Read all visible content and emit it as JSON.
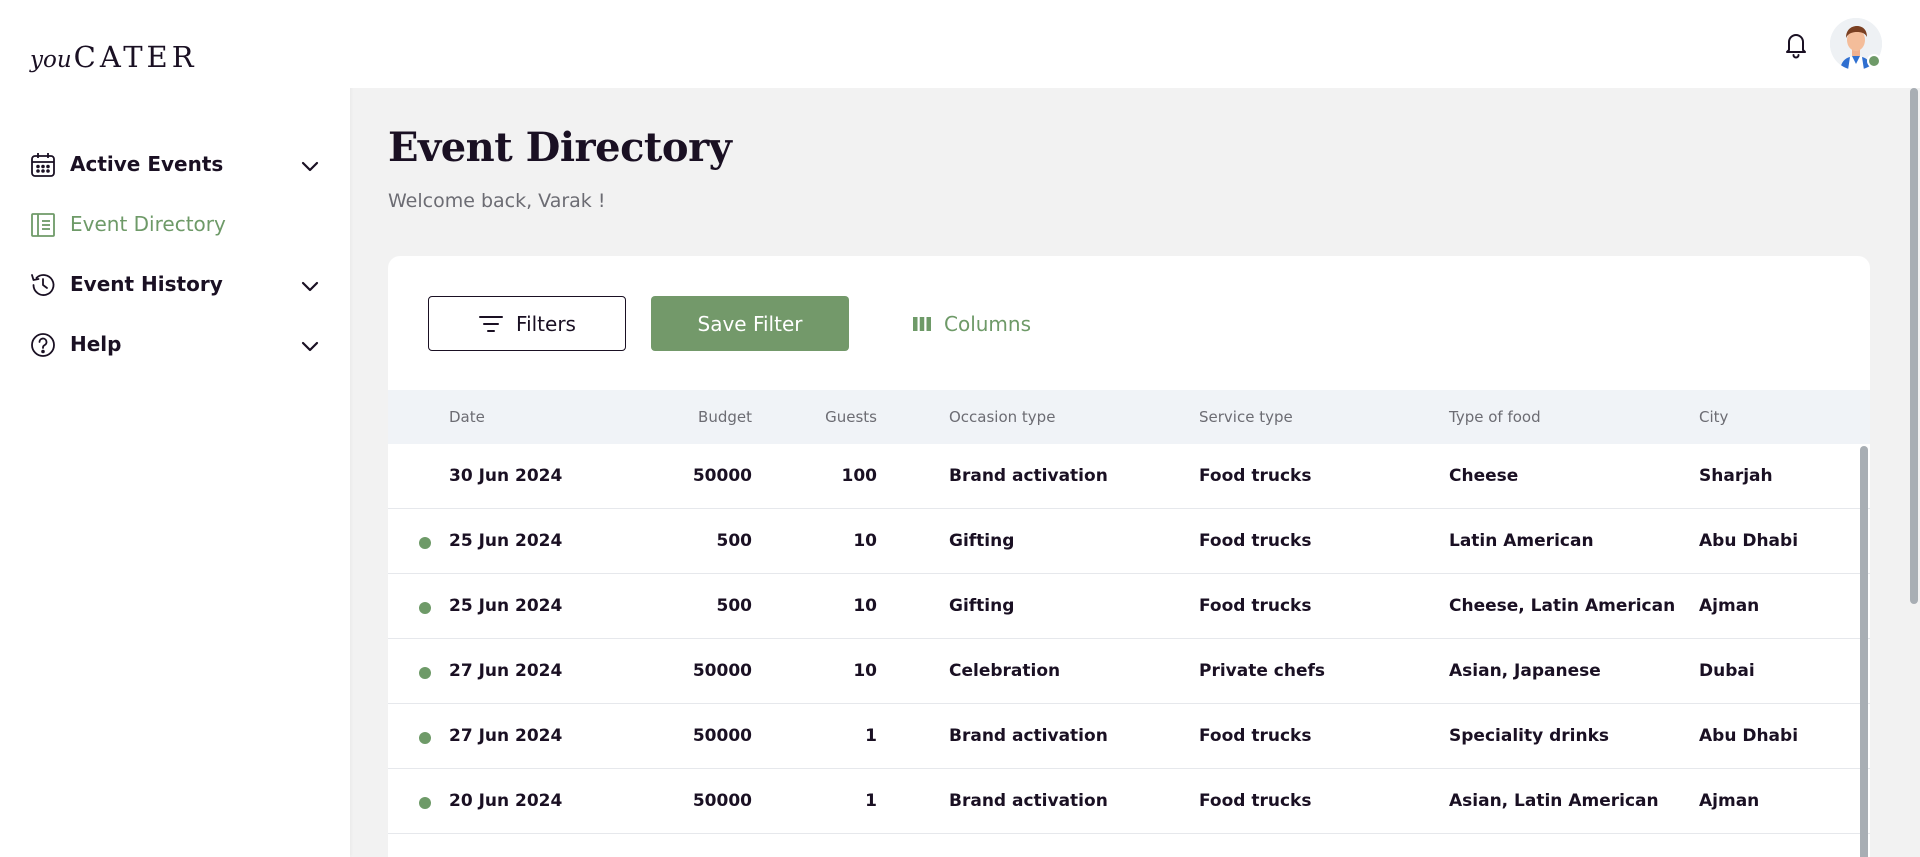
{
  "logo": {
    "prefix": "you",
    "name": "CATER"
  },
  "sidebar": {
    "items": [
      {
        "label": "Active Events",
        "icon": "calendar-icon",
        "expandable": true,
        "active": false
      },
      {
        "label": "Event Directory",
        "icon": "directory-icon",
        "expandable": false,
        "active": true
      },
      {
        "label": "Event History",
        "icon": "history-icon",
        "expandable": true,
        "active": false
      },
      {
        "label": "Help",
        "icon": "help-icon",
        "expandable": true,
        "active": false
      }
    ]
  },
  "header": {
    "notifications_icon": "bell-icon",
    "avatar": "user-avatar",
    "status": "online"
  },
  "page": {
    "title": "Event Directory",
    "welcome": "Welcome back, Varak !"
  },
  "toolbar": {
    "filters_label": "Filters",
    "save_filter_label": "Save Filter",
    "columns_label": "Columns"
  },
  "table": {
    "columns": [
      "Date",
      "Budget",
      "Guests",
      "Occasion type",
      "Service type",
      "Type of food",
      "City"
    ],
    "rows": [
      {
        "dot": false,
        "date": "30 Jun 2024",
        "budget": "50000",
        "guests": "100",
        "occasion": "Brand activation",
        "service": "Food trucks",
        "food": "Cheese",
        "city": "Sharjah"
      },
      {
        "dot": true,
        "date": "25 Jun 2024",
        "budget": "500",
        "guests": "10",
        "occasion": "Gifting",
        "service": "Food trucks",
        "food": "Latin American",
        "city": "Abu Dhabi"
      },
      {
        "dot": true,
        "date": "25 Jun 2024",
        "budget": "500",
        "guests": "10",
        "occasion": "Gifting",
        "service": "Food trucks",
        "food": "Cheese, Latin American",
        "city": "Ajman"
      },
      {
        "dot": true,
        "date": "27 Jun 2024",
        "budget": "50000",
        "guests": "10",
        "occasion": "Celebration",
        "service": "Private chefs",
        "food": "Asian, Japanese",
        "city": "Dubai"
      },
      {
        "dot": true,
        "date": "27 Jun 2024",
        "budget": "50000",
        "guests": "1",
        "occasion": "Brand activation",
        "service": "Food trucks",
        "food": "Speciality drinks",
        "city": "Abu Dhabi"
      },
      {
        "dot": true,
        "date": "20 Jun 2024",
        "budget": "50000",
        "guests": "1",
        "occasion": "Brand activation",
        "service": "Food trucks",
        "food": "Asian, Latin American",
        "city": "Ajman"
      }
    ]
  },
  "colors": {
    "accent": "#6e9a68",
    "button": "#73996a",
    "text": "#1a1023",
    "muted": "#6c6c73",
    "header_bg": "#f0f3f7"
  }
}
